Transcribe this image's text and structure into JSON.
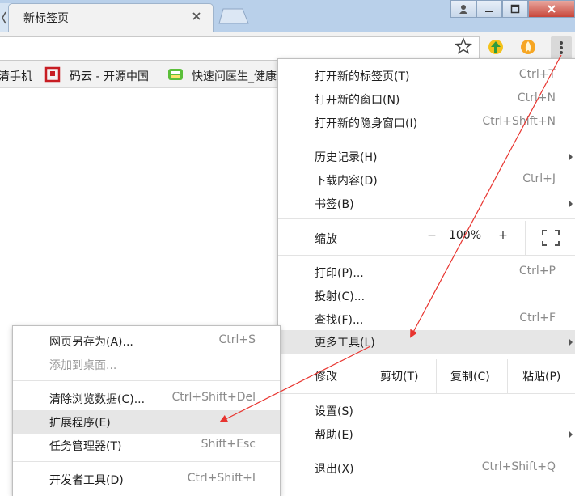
{
  "tab": {
    "title": "新标签页"
  },
  "bookmarks": [
    {
      "label": "清手机"
    },
    {
      "label": "码云 - 开源中国"
    },
    {
      "label": "快速问医生_健康"
    }
  ],
  "main_menu": {
    "group1": [
      {
        "label": "打开新的标签页(T)",
        "shortcut": "Ctrl+T"
      },
      {
        "label": "打开新的窗口(N)",
        "shortcut": "Ctrl+N"
      },
      {
        "label": "打开新的隐身窗口(I)",
        "shortcut": "Ctrl+Shift+N"
      }
    ],
    "group2": [
      {
        "label": "历史记录(H)",
        "shortcut": ""
      },
      {
        "label": "下载内容(D)",
        "shortcut": "Ctrl+J"
      },
      {
        "label": "书签(B)",
        "shortcut": ""
      }
    ],
    "zoom": {
      "label": "缩放",
      "minus": "−",
      "value": "100%",
      "plus": "+"
    },
    "group3": [
      {
        "label": "打印(P)...",
        "shortcut": "Ctrl+P"
      },
      {
        "label": "投射(C)...",
        "shortcut": ""
      },
      {
        "label": "查找(F)...",
        "shortcut": "Ctrl+F"
      },
      {
        "label": "更多工具(L)",
        "shortcut": ""
      }
    ],
    "edit": {
      "label": "修改",
      "cut": "剪切(T)",
      "copy": "复制(C)",
      "paste": "粘贴(P)"
    },
    "group4": [
      {
        "label": "设置(S)",
        "shortcut": ""
      },
      {
        "label": "帮助(E)",
        "shortcut": ""
      }
    ],
    "exit": {
      "label": "退出(X)",
      "shortcut": "Ctrl+Shift+Q"
    }
  },
  "sub_menu": {
    "items": [
      {
        "label": "网页另存为(A)...",
        "shortcut": "Ctrl+S"
      },
      {
        "label": "添加到桌面...",
        "shortcut": ""
      },
      {
        "label": "清除浏览数据(C)...",
        "shortcut": "Ctrl+Shift+Del"
      },
      {
        "label": "扩展程序(E)",
        "shortcut": ""
      },
      {
        "label": "任务管理器(T)",
        "shortcut": "Shift+Esc"
      },
      {
        "label": "开发者工具(D)",
        "shortcut": "Ctrl+Shift+I"
      }
    ]
  },
  "colors": {
    "annotation_arrow": "#e8342f",
    "highlight": "#e6e6e6",
    "titlebar": "#b9d0ea"
  }
}
